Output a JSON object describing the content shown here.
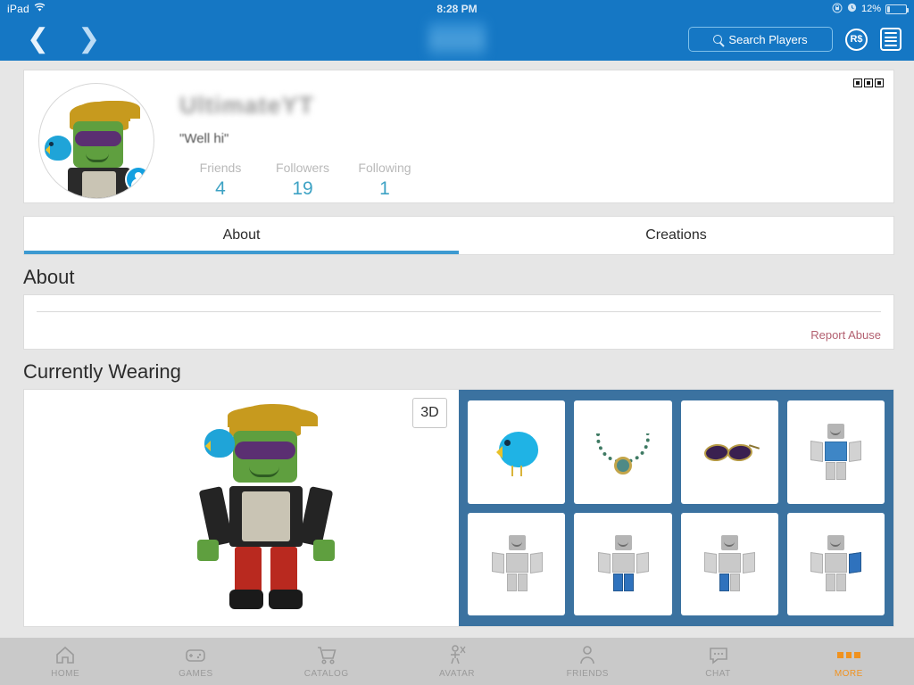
{
  "statusbar": {
    "device": "iPad",
    "wifi_icon": "wifi-icon",
    "time": "8:28 PM",
    "battery_percent": "12%",
    "lock_icon": "rotation-lock-icon",
    "alarm_icon": "alarm-icon"
  },
  "appbar": {
    "back_icon": "chevron-left-icon",
    "forward_icon": "chevron-right-icon",
    "search_label": "Search Players",
    "search_icon": "search-icon",
    "robux_label": "R$",
    "menu_icon": "hamburger-menu-icon"
  },
  "profile": {
    "username": "UltimateYT",
    "status": "\"Well hi\"",
    "overflow_icon": "three-dots-icon",
    "avatar_badge_icon": "user-badge-icon",
    "stats": [
      {
        "label": "Friends",
        "value": "4"
      },
      {
        "label": "Followers",
        "value": "19"
      },
      {
        "label": "Following",
        "value": "1"
      }
    ]
  },
  "tabs": [
    {
      "label": "About",
      "active": true
    },
    {
      "label": "Creations",
      "active": false
    }
  ],
  "about": {
    "heading": "About",
    "description": "",
    "report_label": "Report Abuse"
  },
  "wearing": {
    "heading": "Currently Wearing",
    "view_toggle_label": "3D",
    "items": [
      {
        "name": "blue-bird-shoulder-pet",
        "art": "bird"
      },
      {
        "name": "jade-pendant-necklace",
        "art": "necklace"
      },
      {
        "name": "purple-sunglasses",
        "art": "sunglasses"
      },
      {
        "name": "blue-checkered-shirt",
        "art": "mannequin-shirt"
      },
      {
        "name": "default-mannequin-item-5",
        "art": "mannequin-plain"
      },
      {
        "name": "blue-pants-item-6",
        "art": "mannequin-pants"
      },
      {
        "name": "blue-leg-item-7",
        "art": "mannequin-leg"
      },
      {
        "name": "blue-arm-item-8",
        "art": "mannequin-arm"
      }
    ]
  },
  "tabbar": {
    "items": [
      {
        "label": "HOME",
        "icon": "home-icon",
        "active": false
      },
      {
        "label": "GAMES",
        "icon": "gamepad-icon",
        "active": false
      },
      {
        "label": "CATALOG",
        "icon": "shopping-cart-icon",
        "active": false
      },
      {
        "label": "AVATAR",
        "icon": "avatar-icon",
        "active": false
      },
      {
        "label": "FRIENDS",
        "icon": "people-icon",
        "active": false
      },
      {
        "label": "CHAT",
        "icon": "chat-bubble-icon",
        "active": false
      },
      {
        "label": "MORE",
        "icon": "more-squares-icon",
        "active": true
      }
    ]
  },
  "colors": {
    "header_blue": "#1577c4",
    "panel_blue": "#3b72a0",
    "tab_underline": "#3d9ad1",
    "stat_value": "#3da2c4",
    "accent_orange": "#f0921f",
    "report_red": "#b36070"
  }
}
